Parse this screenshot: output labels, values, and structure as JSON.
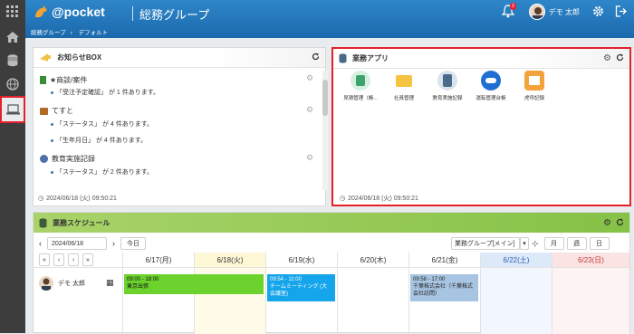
{
  "header": {
    "logo": "@pocket",
    "group": "総務グループ",
    "breadcrumb": [
      "総務グループ",
      "デフォルト"
    ],
    "badge": "3",
    "user": "デモ 太郎"
  },
  "notice": {
    "title": "お知らせBOX",
    "sections": [
      {
        "name": "★商談/案件",
        "lines": [
          "「受注予定確認」 が 1 件あります。"
        ]
      },
      {
        "name": "てすと",
        "lines": [
          "「ステータス」 が 4 件あります。",
          "「生年月日」 が 4 件あります。"
        ]
      },
      {
        "name": "教育実施記録",
        "lines": [
          "「ステータス」 が 2 件あります。"
        ]
      }
    ],
    "timestamp": "2024/06/18 (火) 09:50:21"
  },
  "apps": {
    "title": "業務アプリ",
    "items": [
      "見積管理（帳...",
      "社員管理",
      "教育実施記録",
      "運転管理台帳",
      "虎呼記録"
    ],
    "timestamp": "2024/06/18 (火) 09:50:21"
  },
  "schedule": {
    "title": "業務スケジュール",
    "date": "2024/06/18",
    "today": "今日",
    "group_select": "業務グループ[メイン]",
    "views": [
      "月",
      "週",
      "日"
    ],
    "days": [
      "6/17(月)",
      "6/18(火)",
      "6/19(水)",
      "6/20(木)",
      "6/21(金)",
      "6/22(土)",
      "6/23(日)"
    ],
    "user": "デモ 太郎",
    "events": [
      {
        "time": "09:00 - 18:00",
        "title": "東京出張"
      },
      {
        "time": "09:54 - 11:00",
        "title": "チームミーティング (大会議室)"
      },
      {
        "time": "09:58 - 17:00",
        "title": "千葉株式会社（千葉株式会社訪問）"
      }
    ]
  }
}
